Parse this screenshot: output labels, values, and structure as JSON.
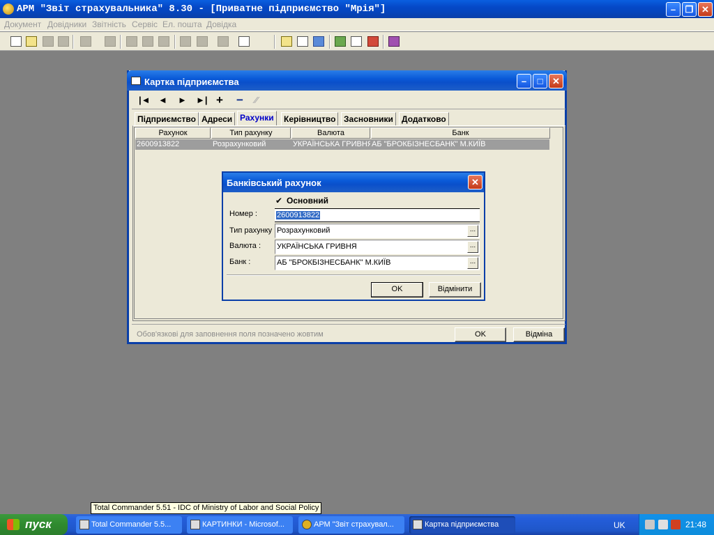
{
  "app": {
    "title": "АРМ \"Звіт страхувальника\" 8.30 - [Приватне підприємство \"Мрія\"]"
  },
  "menu": [
    "Документ",
    "Довідники",
    "Звітність",
    "Сервіс",
    "Ел. пошта",
    "Довідка"
  ],
  "card_window": {
    "title": "Картка підприємства",
    "nav_buttons": [
      "|◄",
      "◄",
      "►",
      "►|",
      "+",
      "−",
      "⁄⁄"
    ],
    "tabs": [
      "Підприємство",
      "Адреси",
      "Рахунки",
      "Керівництво",
      "Засновники",
      "Додатково"
    ],
    "active_tab": "Рахунки",
    "grid": {
      "columns": [
        "Рахунок",
        "Тип рахунку",
        "Валюта",
        "Банк"
      ],
      "rows": [
        [
          "2600913822",
          "Розрахунковий",
          "УКРАЇНСЬКА ГРИВНЯ",
          "АБ \"БРОКБІЗНЕСБАНК\" М.КИЇВ"
        ]
      ]
    },
    "hint": "Обов'язкові для заповнення поля позначено жовтим",
    "ok_label": "OK",
    "cancel_label": "Відміна"
  },
  "dialog": {
    "title": "Банківський рахунок",
    "main_check": {
      "label": "Основний",
      "checked": true
    },
    "fields": [
      {
        "label": "Номер :",
        "value": "2600913822"
      },
      {
        "label": "Тип рахунку",
        "value": "Розрахунковий"
      },
      {
        "label": "Валюта :",
        "value": "УКРАЇНСЬКА ГРИВНЯ"
      },
      {
        "label": "Банк :",
        "value": "АБ \"БРОКБІЗНЕСБАНК\" М.КИЇВ"
      }
    ],
    "browse_label": "...",
    "ok_label": "OK",
    "cancel_label": "Відмінити"
  },
  "tooltip": "Total Commander 5.51 - IDC of Ministry of Labor and Social Policy",
  "taskbar": {
    "start_label": "пуск",
    "tasks": [
      "Total Commander 5.5...",
      "КАРТИНКИ - Microsof...",
      "АРМ \"Звіт страхувал...",
      "Картка підприємства"
    ],
    "active_task": 3,
    "language": "UK",
    "clock": "21:48"
  }
}
